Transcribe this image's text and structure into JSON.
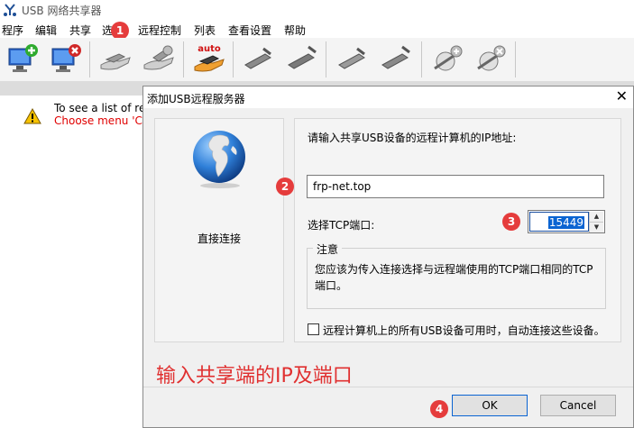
{
  "window": {
    "title": "USB 网络共享器",
    "icon": "usb-share-app-icon"
  },
  "menu": [
    "程序",
    "编辑",
    "共享",
    "选",
    "远程控制",
    "列表",
    "查看设置",
    "帮助"
  ],
  "toolbar": {
    "buttons": [
      "add-computer-icon",
      "remove-computer-icon",
      "share-device-icon",
      "unshare-device-icon",
      "auto-share-icon",
      "connect-device-icon",
      "disconnect-device-icon",
      "connect-remote-icon",
      "disconnect-remote-icon",
      "add-remote-server-icon",
      "remove-remote-server-icon"
    ],
    "auto_label": "auto"
  },
  "list": {
    "line1": "To see a list of re",
    "line2": "Choose menu 'Co"
  },
  "dialog": {
    "title": "添加USB远程服务器",
    "left_label": "直接连接",
    "ip_prompt": "请输入共享USB设备的远程计算机的IP地址:",
    "ip_value": "frp-net.top",
    "port_label": "选择TCP端口:",
    "port_value": "15449",
    "notice_title": "注意",
    "notice_text": "您应该为传入连接选择与远程端使用的TCP端口相同的TCP端口。",
    "auto_connect_label": "远程计算机上的所有USB设备可用时，自动连接这些设备。",
    "auto_connect_checked": false,
    "annotation": "输入共享端的IP及端口",
    "ok_label": "OK",
    "cancel_label": "Cancel",
    "close_glyph": "✕"
  },
  "markers": [
    "1",
    "2",
    "3",
    "4"
  ],
  "colors": {
    "marker": "#e53c3c",
    "annotation": "#e03030",
    "warning_text": "#e00000",
    "selection": "#0a64d2"
  }
}
